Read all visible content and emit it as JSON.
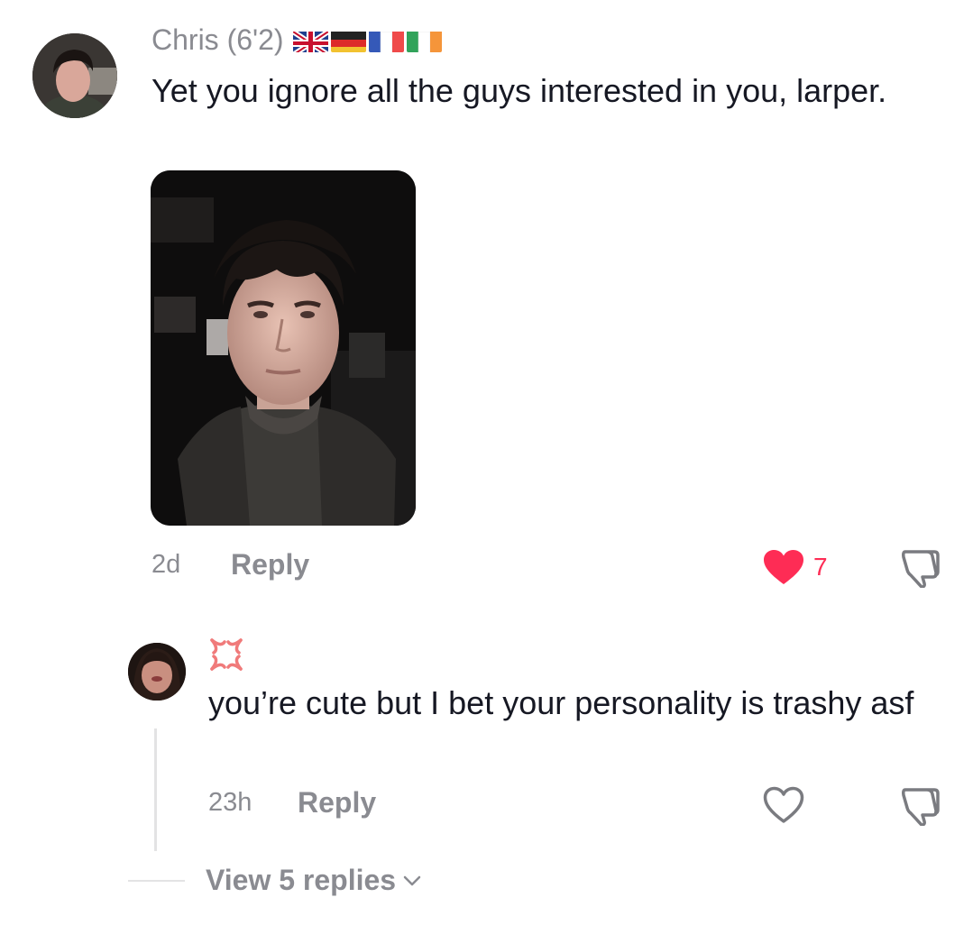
{
  "comment": {
    "username": "Chris (6'2)",
    "flags": [
      "uk-flag",
      "germany-flag",
      "france-flag",
      "ireland-flag"
    ],
    "text": "Yet you ignore all the guys interested in you, larper.",
    "time": "2d",
    "reply_label": "Reply",
    "like_count": "7",
    "liked": true
  },
  "reply": {
    "username_emoji": "angry-symbol-emoji",
    "text": "you’re cute but I bet your personality is trashy asf",
    "time": "23h",
    "reply_label": "Reply",
    "liked": false
  },
  "view_replies": {
    "label": "View 5 replies"
  },
  "colors": {
    "like_red": "#fe2c55",
    "secondary_text": "#8a8b91",
    "primary_text": "#161823"
  }
}
